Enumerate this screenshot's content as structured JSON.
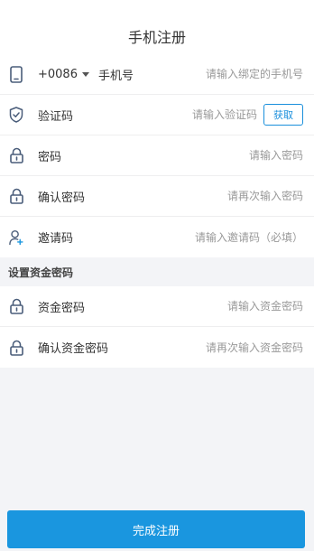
{
  "header": {
    "title": "手机注册"
  },
  "form": {
    "phone": {
      "country_code": "+0086",
      "label": "手机号",
      "placeholder": "请输入绑定的手机号"
    },
    "verify": {
      "label": "验证码",
      "placeholder": "请输入验证码",
      "button": "获取"
    },
    "password": {
      "label": "密码",
      "placeholder": "请输入密码"
    },
    "confirm_password": {
      "label": "确认密码",
      "placeholder": "请再次输入密码"
    },
    "invite": {
      "label": "邀请码",
      "placeholder": "请输入邀请码（必填）"
    }
  },
  "fund_section": {
    "title": "设置资金密码",
    "fund_password": {
      "label": "资金密码",
      "placeholder": "请输入资金密码"
    },
    "confirm_fund_password": {
      "label": "确认资金密码",
      "placeholder": "请再次输入资金密码"
    }
  },
  "submit": {
    "label": "完成注册"
  },
  "colors": {
    "accent": "#1a96df",
    "icon": "#4a5d7a"
  }
}
